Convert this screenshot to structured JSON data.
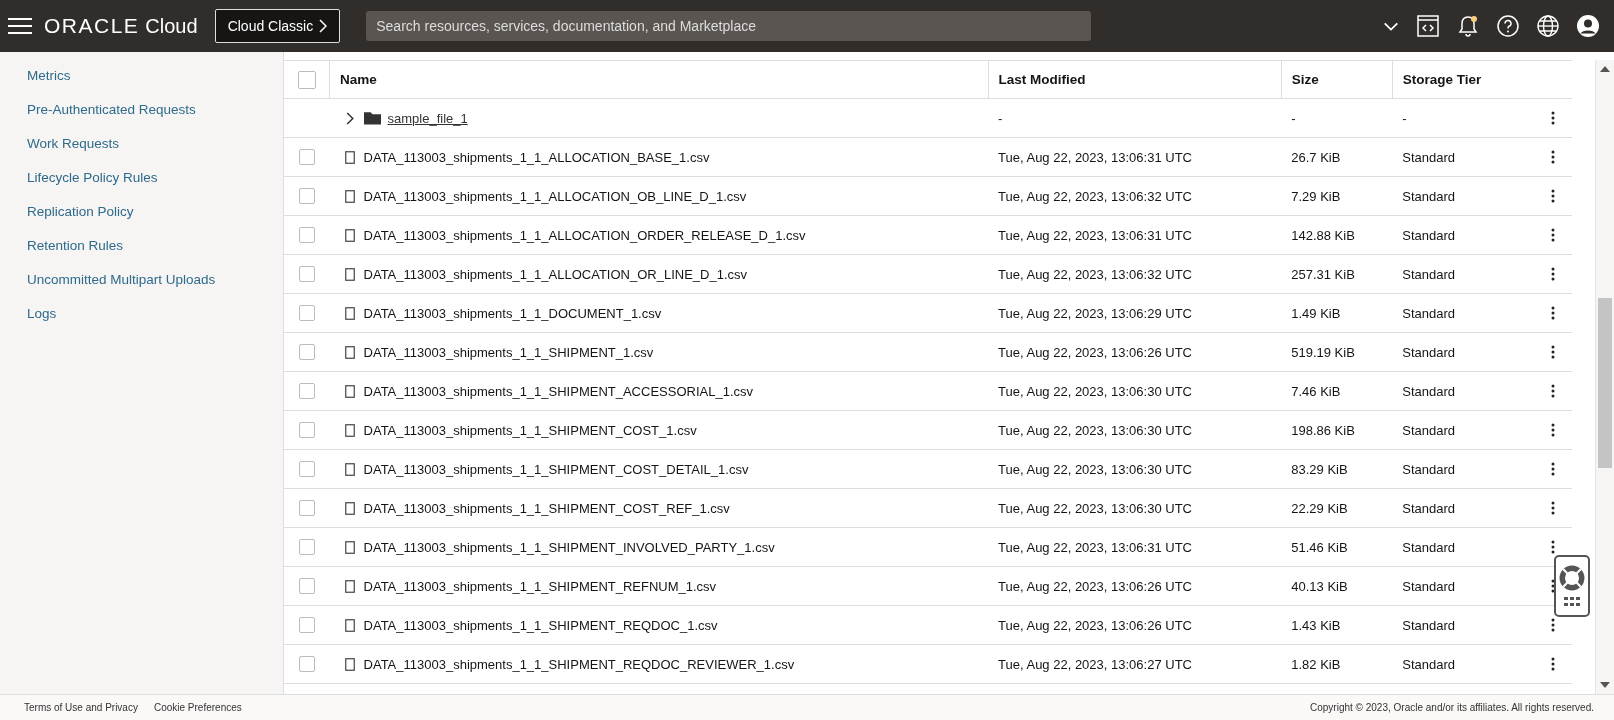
{
  "header": {
    "brand": "ORACLE",
    "brand_suffix": "Cloud",
    "classic_button": "Cloud Classic",
    "search": {
      "placeholder": "Search resources, services, documentation, and Marketplace"
    },
    "notification_unread": true
  },
  "sidebar": {
    "items": [
      "Metrics",
      "Pre-Authenticated Requests",
      "Work Requests",
      "Lifecycle Policy Rules",
      "Replication Policy",
      "Retention Rules",
      "Uncommitted Multipart Uploads",
      "Logs"
    ]
  },
  "table": {
    "select_all_checked": false,
    "columns": [
      "Name",
      "Last Modified",
      "Size",
      "Storage Tier"
    ],
    "rows": [
      {
        "kind": "folder",
        "name": "sample_file_1",
        "modified": "-",
        "size": "-",
        "tier": "-"
      },
      {
        "kind": "file",
        "checked": false,
        "name": "DATA_113003_shipments_1_1_ALLOCATION_BASE_1.csv",
        "modified": "Tue, Aug 22, 2023, 13:06:31 UTC",
        "size": "26.7 KiB",
        "tier": "Standard"
      },
      {
        "kind": "file",
        "checked": false,
        "name": "DATA_113003_shipments_1_1_ALLOCATION_OB_LINE_D_1.csv",
        "modified": "Tue, Aug 22, 2023, 13:06:32 UTC",
        "size": "7.29 KiB",
        "tier": "Standard"
      },
      {
        "kind": "file",
        "checked": false,
        "name": "DATA_113003_shipments_1_1_ALLOCATION_ORDER_RELEASE_D_1.csv",
        "modified": "Tue, Aug 22, 2023, 13:06:31 UTC",
        "size": "142.88 KiB",
        "tier": "Standard"
      },
      {
        "kind": "file",
        "checked": false,
        "name": "DATA_113003_shipments_1_1_ALLOCATION_OR_LINE_D_1.csv",
        "modified": "Tue, Aug 22, 2023, 13:06:32 UTC",
        "size": "257.31 KiB",
        "tier": "Standard"
      },
      {
        "kind": "file",
        "checked": false,
        "name": "DATA_113003_shipments_1_1_DOCUMENT_1.csv",
        "modified": "Tue, Aug 22, 2023, 13:06:29 UTC",
        "size": "1.49 KiB",
        "tier": "Standard"
      },
      {
        "kind": "file",
        "checked": false,
        "name": "DATA_113003_shipments_1_1_SHIPMENT_1.csv",
        "modified": "Tue, Aug 22, 2023, 13:06:26 UTC",
        "size": "519.19 KiB",
        "tier": "Standard"
      },
      {
        "kind": "file",
        "checked": false,
        "name": "DATA_113003_shipments_1_1_SHIPMENT_ACCESSORIAL_1.csv",
        "modified": "Tue, Aug 22, 2023, 13:06:30 UTC",
        "size": "7.46 KiB",
        "tier": "Standard"
      },
      {
        "kind": "file",
        "checked": false,
        "name": "DATA_113003_shipments_1_1_SHIPMENT_COST_1.csv",
        "modified": "Tue, Aug 22, 2023, 13:06:30 UTC",
        "size": "198.86 KiB",
        "tier": "Standard"
      },
      {
        "kind": "file",
        "checked": false,
        "name": "DATA_113003_shipments_1_1_SHIPMENT_COST_DETAIL_1.csv",
        "modified": "Tue, Aug 22, 2023, 13:06:30 UTC",
        "size": "83.29 KiB",
        "tier": "Standard"
      },
      {
        "kind": "file",
        "checked": false,
        "name": "DATA_113003_shipments_1_1_SHIPMENT_COST_REF_1.csv",
        "modified": "Tue, Aug 22, 2023, 13:06:30 UTC",
        "size": "22.29 KiB",
        "tier": "Standard"
      },
      {
        "kind": "file",
        "checked": false,
        "name": "DATA_113003_shipments_1_1_SHIPMENT_INVOLVED_PARTY_1.csv",
        "modified": "Tue, Aug 22, 2023, 13:06:31 UTC",
        "size": "51.46 KiB",
        "tier": "Standard"
      },
      {
        "kind": "file",
        "checked": false,
        "name": "DATA_113003_shipments_1_1_SHIPMENT_REFNUM_1.csv",
        "modified": "Tue, Aug 22, 2023, 13:06:26 UTC",
        "size": "40.13 KiB",
        "tier": "Standard"
      },
      {
        "kind": "file",
        "checked": false,
        "name": "DATA_113003_shipments_1_1_SHIPMENT_REQDOC_1.csv",
        "modified": "Tue, Aug 22, 2023, 13:06:26 UTC",
        "size": "1.43 KiB",
        "tier": "Standard"
      },
      {
        "kind": "file",
        "checked": false,
        "name": "DATA_113003_shipments_1_1_SHIPMENT_REQDOC_REVIEWER_1.csv",
        "modified": "Tue, Aug 22, 2023, 13:06:27 UTC",
        "size": "1.82 KiB",
        "tier": "Standard"
      }
    ]
  },
  "footer": {
    "links": [
      "Terms of Use and Privacy",
      "Cookie Preferences"
    ],
    "copyright": "Copyright © 2023, Oracle and/or its affiliates. All rights reserved."
  }
}
